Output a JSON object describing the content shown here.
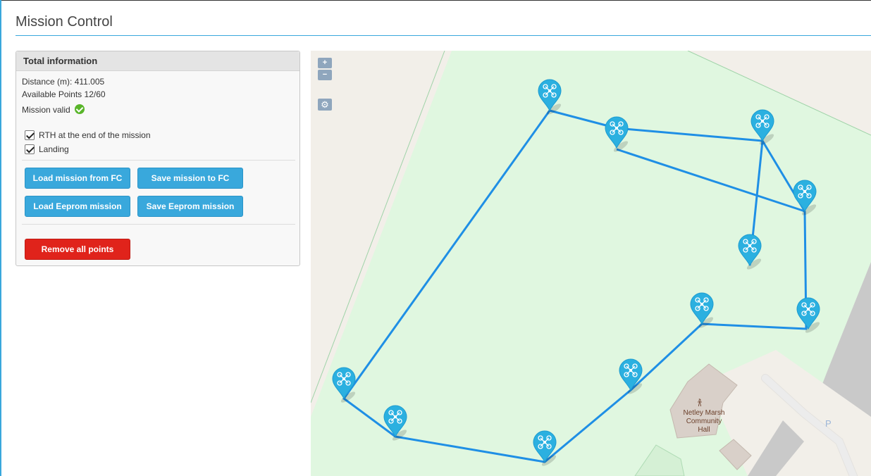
{
  "header": {
    "title": "Mission Control"
  },
  "total_info": {
    "title": "Total information",
    "distance_label": "Distance (m):",
    "distance_value": "411.005",
    "points_label": "Available Points",
    "points_value": "12/60",
    "valid_label": "Mission valid",
    "rth_label": "RTH at the end of the mission",
    "rth_checked": true,
    "landing_label": "Landing",
    "landing_checked": true
  },
  "buttons": {
    "load_fc": "Load mission from FC",
    "save_fc": "Save mission to FC",
    "load_eeprom": "Load Eeprom mission",
    "save_eeprom": "Save Eeprom mission",
    "remove_all": "Remove all points"
  },
  "map": {
    "zoom_in": "+",
    "zoom_out": "−",
    "settings_icon": "gear-icon",
    "poi_name": "Netley Marsh Community Hall",
    "poi_icon": "community-hall-icon",
    "parking": "P",
    "marker_icon": "drone-icon"
  },
  "colors": {
    "accent": "#39a8dc",
    "danger": "#e0231b",
    "valid": "#59b52a",
    "route": "#1f8fe5",
    "map_green": "#e0f7e0"
  }
}
